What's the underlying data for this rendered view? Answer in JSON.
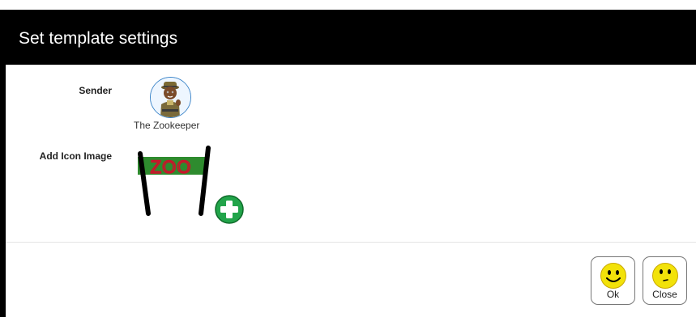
{
  "dialog": {
    "title": "Set template settings"
  },
  "form": {
    "sender_label": "Sender",
    "sender_name": "The Zookeeper",
    "icon_label": "Add Icon Image",
    "icon_sign_text": "ZOO"
  },
  "buttons": {
    "ok_label": "Ok",
    "close_label": "Close"
  },
  "colors": {
    "header_bg": "#000000",
    "sign_green": "#2e8b2e",
    "sign_text_red": "#d0102a",
    "add_green": "#22a44a",
    "smiley_yellow": "#f2e20a"
  },
  "icons": {
    "avatar": "zookeeper-avatar-icon",
    "sign": "zoo-sign-image",
    "add": "plus-circle-icon",
    "ok": "smile-face-icon",
    "close": "neutral-face-icon"
  }
}
